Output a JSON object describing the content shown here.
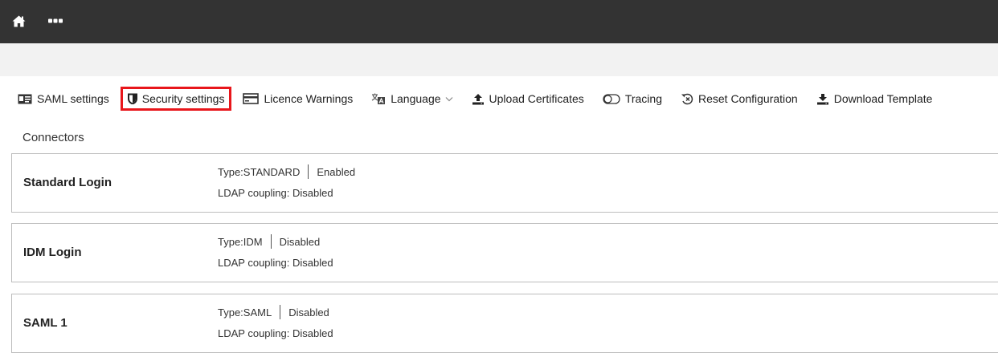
{
  "header": {
    "home_icon": "home-icon",
    "more_icon": "more-icon"
  },
  "toolbar": {
    "items": [
      {
        "label": "SAML settings",
        "icon": "id-card-icon"
      },
      {
        "label": "Security settings",
        "icon": "shield-icon"
      },
      {
        "label": "Licence Warnings",
        "icon": "credit-card-icon"
      },
      {
        "label": "Language",
        "icon": "translate-icon"
      },
      {
        "label": "Upload Certificates",
        "icon": "upload-icon"
      },
      {
        "label": "Tracing",
        "icon": "toggle-icon"
      },
      {
        "label": "Reset Configuration",
        "icon": "reset-icon"
      },
      {
        "label": "Download Template",
        "icon": "download-icon"
      }
    ],
    "highlight_color": "#e8161b"
  },
  "connectors": {
    "title": "Connectors",
    "items": [
      {
        "name": "Standard Login",
        "type": "Type:STANDARD",
        "status": "Enabled",
        "ldap": "LDAP coupling: Disabled"
      },
      {
        "name": "IDM Login",
        "type": "Type:IDM",
        "status": "Disabled",
        "ldap": "LDAP coupling: Disabled"
      },
      {
        "name": "SAML 1",
        "type": "Type:SAML",
        "status": "Disabled",
        "ldap": "LDAP coupling: Disabled"
      }
    ]
  },
  "colors": {
    "topbar": "#333333",
    "subbar": "#f2f2f2"
  }
}
